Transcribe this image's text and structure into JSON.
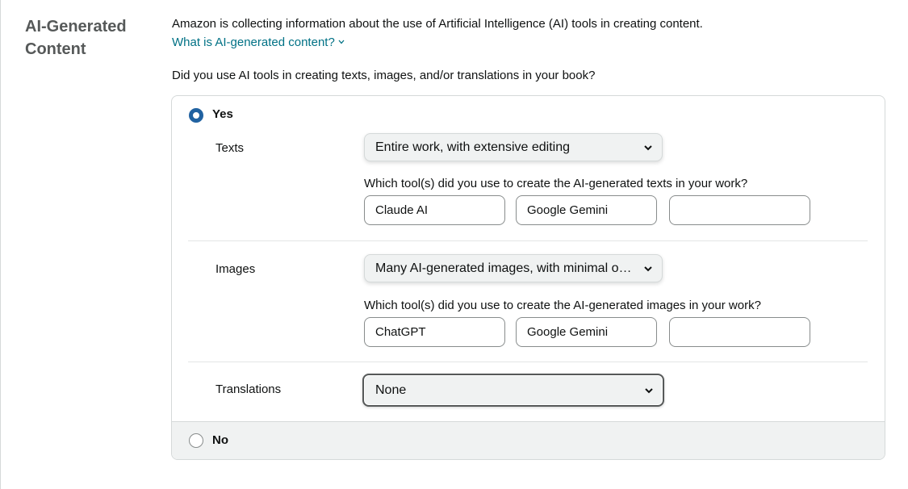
{
  "section": {
    "title": "AI-Generated Content"
  },
  "intro": {
    "text": "Amazon is collecting information about the use of Artificial Intelligence (AI) tools in creating content.",
    "link_label": "What is AI-generated content?",
    "link_icon": "chevron-down-icon"
  },
  "question": {
    "text": "Did you use AI tools in creating texts, images, and/or translations in your book?"
  },
  "options": {
    "yes_label": "Yes",
    "no_label": "No",
    "selected": "Yes"
  },
  "texts": {
    "label": "Texts",
    "select_value": "Entire work, with extensive editing",
    "tools_question": "Which tool(s) did you use to create the AI-generated texts in your work?",
    "tools": [
      "Claude AI",
      "Google Gemini",
      ""
    ]
  },
  "images": {
    "label": "Images",
    "select_value": "Many AI-generated images, with minimal or no editing",
    "tools_question": "Which tool(s) did you use to create the AI-generated images in your work?",
    "tools": [
      "ChatGPT",
      "Google Gemini",
      ""
    ]
  },
  "translations": {
    "label": "Translations",
    "select_value": "None"
  },
  "colors": {
    "link": "#007185",
    "radio_selected": "#2162a1",
    "heading": "#565959",
    "panel_footer_bg": "#f0f2f2"
  }
}
